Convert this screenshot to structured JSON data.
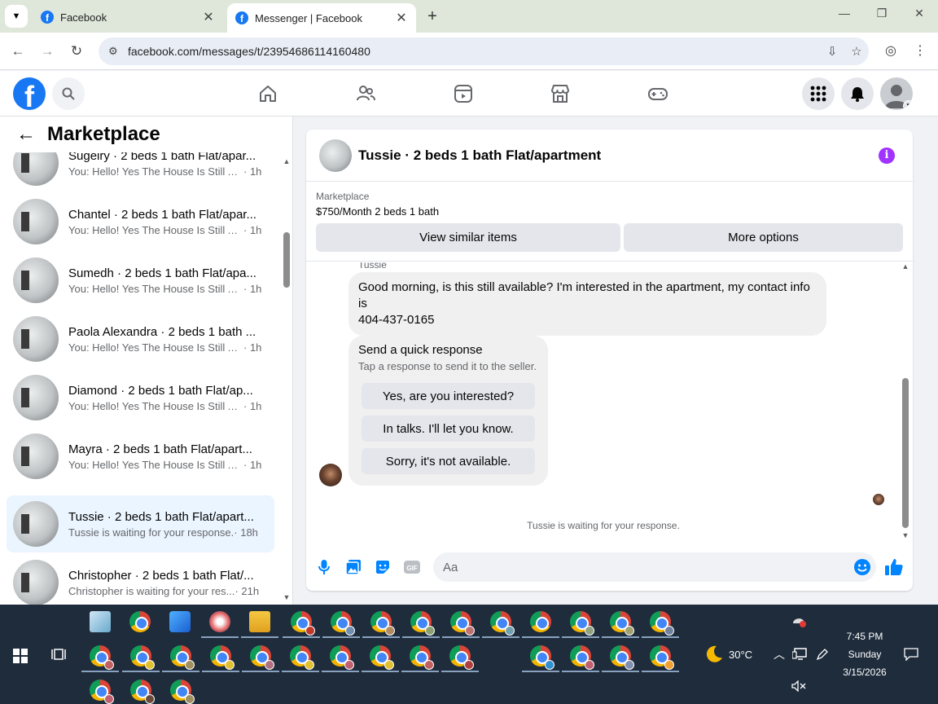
{
  "browser": {
    "tabs": [
      {
        "title": "Facebook",
        "active": false
      },
      {
        "title": "Messenger | Facebook",
        "active": true
      }
    ],
    "url": "facebook.com/messages/t/23954686114160480"
  },
  "fb_header": {
    "logo_letter": "f"
  },
  "sidebar": {
    "title": "Marketplace",
    "conversations": [
      {
        "name": "Sugeiry · 2 beds 1 bath Flat/apar...",
        "preview": "You: Hello! Yes The House Is Still Av...",
        "time": " · 1h",
        "active": false
      },
      {
        "name": "Chantel · 2 beds 1 bath Flat/apar...",
        "preview": "You: Hello! Yes The House Is Still Av...",
        "time": " · 1h",
        "active": false
      },
      {
        "name": "Sumedh · 2 beds 1 bath Flat/apa...",
        "preview": "You: Hello! Yes The House Is Still Av...",
        "time": " · 1h",
        "active": false
      },
      {
        "name": "Paola Alexandra · 2 beds 1 bath ...",
        "preview": "You: Hello! Yes The House Is Still Av...",
        "time": " · 1h",
        "active": false
      },
      {
        "name": "Diamond · 2 beds 1 bath Flat/ap...",
        "preview": "You: Hello! Yes The House Is Still Av...",
        "time": " · 1h",
        "active": false
      },
      {
        "name": "Mayra · 2 beds 1 bath Flat/apart...",
        "preview": "You: Hello! Yes The House Is Still Av...",
        "time": " · 1h",
        "active": false
      },
      {
        "name": "Tussie · 2 beds 1 bath Flat/apart...",
        "preview": "Tussie is waiting for your response.",
        "time": " · 18h",
        "active": true
      },
      {
        "name": "Christopher · 2 beds 1 bath Flat/...",
        "preview": "Christopher is waiting for your res...",
        "time": " · 21h",
        "active": false
      }
    ]
  },
  "chat": {
    "title": "Tussie · 2 beds 1 bath Flat/apartment",
    "listing_source": "Marketplace",
    "listing_price": "$750/Month 2 beds 1 bath",
    "buttons": {
      "similar": "View similar items",
      "more": "More options"
    },
    "sender_name": "Tussie",
    "message_line1": "Good morning, is this still available? I'm interested in the apartment,  my contact info is",
    "message_line2": "404-437-0165",
    "quick_response": {
      "heading": "Send a quick response",
      "subtext": "Tap a response to send it to the seller.",
      "options": [
        "Yes, are you interested?",
        "In talks. I'll let you know.",
        "Sorry, it's not available."
      ]
    },
    "waiting_text": "Tussie is waiting for your response.",
    "composer_placeholder": "Aa"
  },
  "taskbar": {
    "weather": "30°C",
    "time": "7:45 PM",
    "day": "Sunday",
    "date": "3/15/2026"
  },
  "colors": {
    "fb_blue": "#1877f2",
    "messenger_blue": "#0084ff",
    "info_purple": "#a033ff",
    "active_conv": "#ebf5ff",
    "taskbar": "#1e2c3c"
  }
}
